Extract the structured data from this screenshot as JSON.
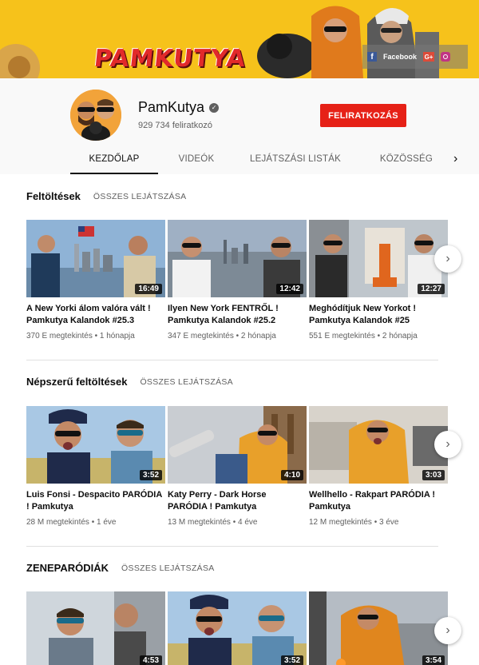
{
  "banner": {
    "logo_text": "PAMKUTYA",
    "links": {
      "facebook_label": "Facebook",
      "googleplus_label": "G+",
      "facebook_letter": "f"
    }
  },
  "channel": {
    "name": "PamKutya",
    "subscribers": "929 734 feliratkozó",
    "subscribe_label": "FELIRATKOZÁS"
  },
  "tabs": [
    "KEZDŐLAP",
    "VIDEÓK",
    "LEJÁTSZÁSI LISTÁK",
    "KÖZÖSSÉG"
  ],
  "sections": [
    {
      "title": "Feltöltések",
      "play_all": "ÖSSZES LEJÁTSZÁSA",
      "videos": [
        {
          "title": "A New Yorki álom valóra vált ! Pamkutya Kalandok #25.3",
          "meta": "370 E megtekintés • 1 hónapja",
          "duration": "16:49"
        },
        {
          "title": "Ilyen New York FENTRŐL ! Pamkutya Kalandok #25.2",
          "meta": "347 E megtekintés • 2 hónapja",
          "duration": "12:42"
        },
        {
          "title": "Meghódítjuk New Yorkot ! Pamkutya Kalandok #25",
          "meta": "551 E megtekintés • 2 hónapja",
          "duration": "12:27"
        }
      ]
    },
    {
      "title": "Népszerű feltöltések",
      "play_all": "ÖSSZES LEJÁTSZÁSA",
      "videos": [
        {
          "title": "Luis Fonsi - Despacito PARÓDIA ! Pamkutya",
          "meta": "28 M megtekintés • 1 éve",
          "duration": "3:52"
        },
        {
          "title": "Katy Perry - Dark Horse PARÓDIA ! Pamkutya",
          "meta": "13 M megtekintés • 4 éve",
          "duration": "4:10"
        },
        {
          "title": "Wellhello - Rakpart PARÓDIA ! Pamkutya",
          "meta": "12 M megtekintés • 3 éve",
          "duration": "3:03"
        }
      ]
    },
    {
      "title": "ZENEPARÓDIÁK",
      "play_all": "ÖSSZES LEJÁTSZÁSA",
      "videos": [
        {
          "duration": "4:53"
        },
        {
          "duration": "3:52"
        },
        {
          "duration": "3:54"
        }
      ]
    }
  ],
  "colors": {
    "banner": "#f6c21b",
    "subscribe": "#e62117",
    "accent_text": "#606060"
  }
}
